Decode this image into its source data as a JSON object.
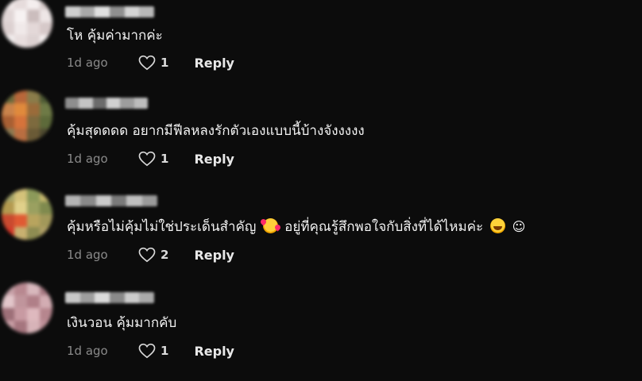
{
  "comments": [
    {
      "text": "โห คุ้มค่ามากค่ะ",
      "time": "1d ago",
      "likes": "1",
      "reply_label": "Reply",
      "avatar_colors": [
        "#efe7e7",
        "#e6dcdc",
        "#f4eeee",
        "#d8cccc",
        "#e1d6d6",
        "#f7f2f2",
        "#cbbdbd",
        "#eee6e6",
        "#dcd0d0",
        "#f0e9e9",
        "#e3d8d8",
        "#d6c9c9",
        "#f2eded",
        "#e8dede",
        "#ddd2d2",
        "#f5f0f0"
      ],
      "username_colors": [
        "#cfcfcf",
        "#a9a9a9",
        "#e0e0e0",
        "#8f8f8f",
        "#d5d5d5",
        "#b8b8b8"
      ]
    },
    {
      "text": "คุ้มสุดดดด อยากมีฟีลหลงรักตัวเองแบบนี้บ้างจังงงงง",
      "time": "1d ago",
      "likes": "1",
      "reply_label": "Reply",
      "avatar_colors": [
        "#6b6a3c",
        "#b8673a",
        "#8a7c4a",
        "#4f5b35",
        "#c9834b",
        "#e08a3c",
        "#9a6b3a",
        "#6e7a46",
        "#a85f33",
        "#d6733b",
        "#7d6a3e",
        "#5d6a3a",
        "#8c7a52",
        "#b96e41",
        "#6a5a36",
        "#4e4a30"
      ],
      "username_colors": [
        "#8e8e8e",
        "#c4c4c4",
        "#6b6b6b",
        "#d0d0d0",
        "#9d9d9d",
        "#bdbdbd"
      ]
    },
    {
      "text_parts": [
        "คุ้มหรือไม่คุ้มไม่ใช่ประเด็นสำคัญ ",
        " อยู่ที่คุณรู้สึกพอใจกับสิ่งที่ได้ไหมค่ะ ",
        ""
      ],
      "smiley": "☺",
      "time": "1d ago",
      "likes": "2",
      "reply_label": "Reply",
      "avatar_colors": [
        "#a6a66a",
        "#d4c27a",
        "#8c9a5a",
        "#c6b86e",
        "#b39a4f",
        "#e0d08a",
        "#9aa060",
        "#7f8a4e",
        "#c94a2f",
        "#e05a33",
        "#b8a45e",
        "#a2985a",
        "#d53a2a",
        "#c8b070",
        "#8e8c52",
        "#b0a066"
      ],
      "username_colors": [
        "#b4b4b4",
        "#8a8a8a",
        "#cacaca",
        "#7a7a7a",
        "#bfbfbf",
        "#9b9b9b"
      ]
    },
    {
      "text": "เงินวอน คุ้มมากคับ",
      "time": "1d ago",
      "likes": "1",
      "reply_label": "Reply",
      "avatar_colors": [
        "#c9a3aa",
        "#b88890",
        "#d8b8bd",
        "#a87a83",
        "#e2c6ca",
        "#c0959c",
        "#b07f88",
        "#d3adb3",
        "#9d6f78",
        "#c89aa2",
        "#deb9be",
        "#b6868e",
        "#caa0a7",
        "#a5757e",
        "#d7b3b8",
        "#bf9199"
      ],
      "username_colors": [
        "#c8c8c8",
        "#9e9e9e",
        "#dadada",
        "#8a8a8a",
        "#cccccc",
        "#aaaaaa"
      ]
    }
  ]
}
